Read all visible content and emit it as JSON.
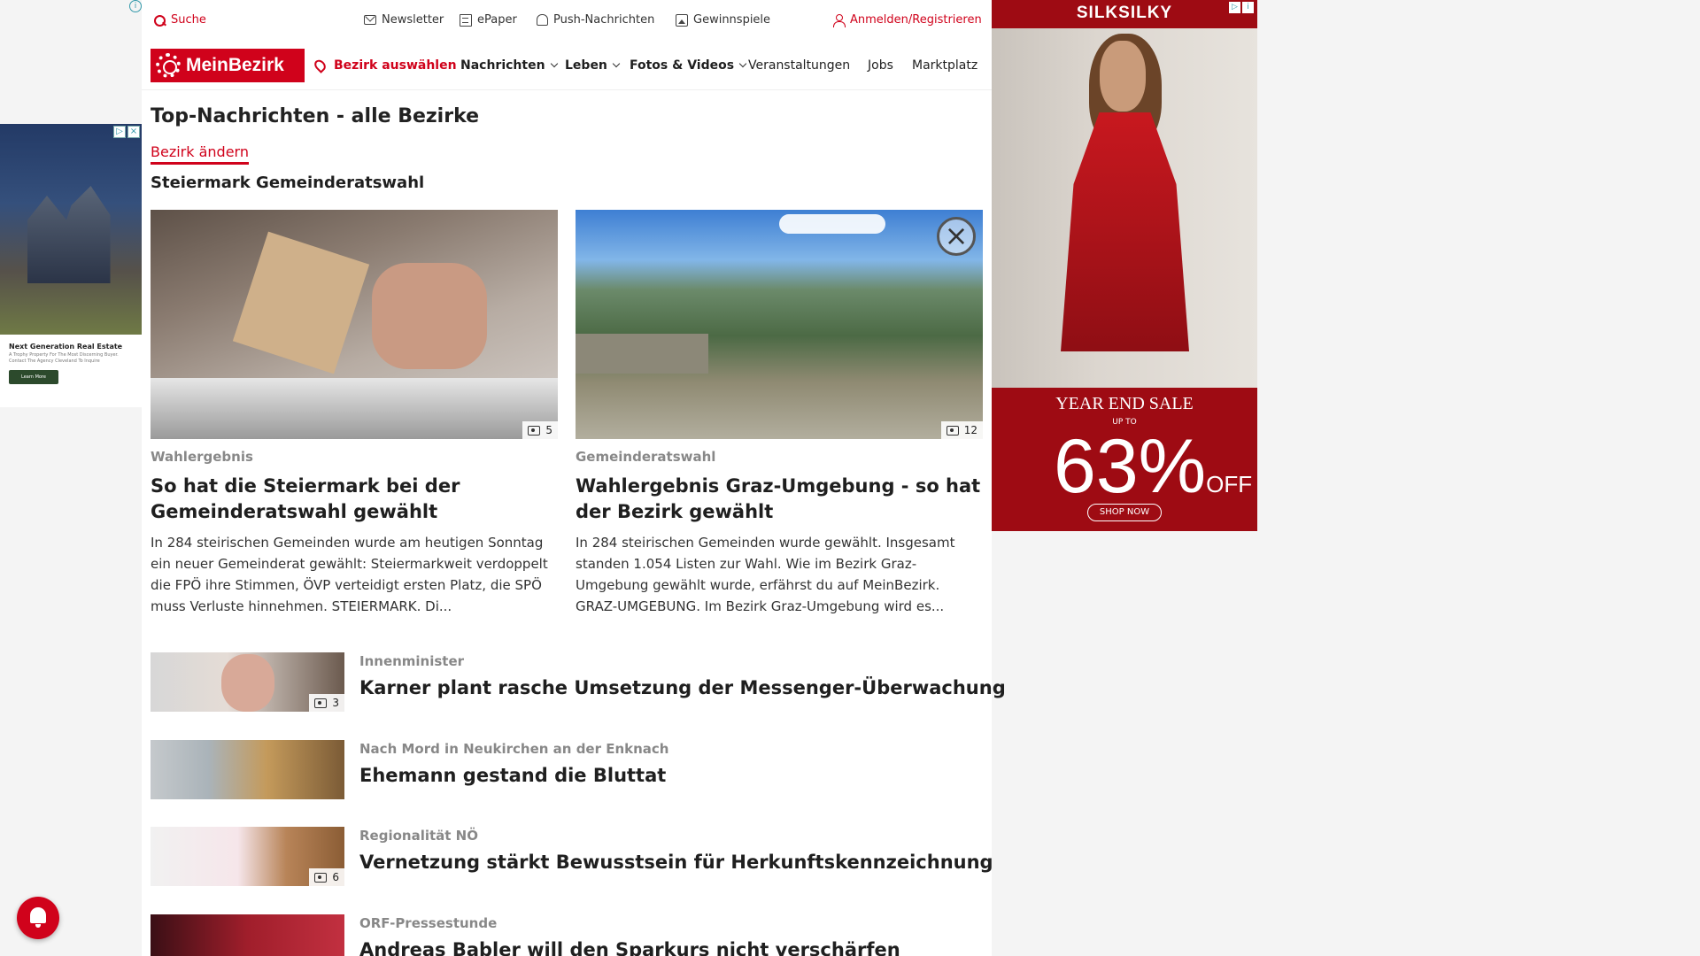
{
  "topbar": {
    "search": "Suche",
    "newsletter": "Newsletter",
    "epaper": "ePaper",
    "push": "Push-Nachrichten",
    "gewinnspiele": "Gewinnspiele",
    "login": "Anmelden/Registrieren"
  },
  "nav": {
    "logo": "MeinBezirk",
    "bezirk": "Bezirk auswählen",
    "nachrichten": "Nachrichten",
    "leben": "Leben",
    "fotos": "Fotos & Videos",
    "veranstaltungen": "Veranstaltungen",
    "jobs": "Jobs",
    "marktplatz": "Marktplatz"
  },
  "page": {
    "heading": "Top-Nachrichten - alle Bezirke",
    "change_district": "Bezirk ändern",
    "section_title": "Steiermark Gemeinderatswahl"
  },
  "cards": [
    {
      "kicker": "Wahlergebnis",
      "title": "So hat die Steiermark bei der Gemeinderatswahl gewählt",
      "teaser": "In 284 steirischen Gemeinden wurde am heutigen Sonntag ein neuer Gemeinderat gewählt: Steiermarkweit verdoppelt die FPÖ ihre Stimmen, ÖVP verteidigt ersten Platz, die SPÖ muss Verluste hinnehmen. STEIERMARK. Di...",
      "photo_count": "5"
    },
    {
      "kicker": "Gemeinderatswahl",
      "title": "Wahlergebnis Graz-Umgebung - so hat der Bezirk gewählt",
      "teaser": "In 284 steirischen Gemeinden wurde gewählt. Insgesamt standen 1.054 Listen zur Wahl. Wie im Bezirk Graz-Umgebung gewählt wurde, erfährst du auf MeinBezirk. GRAZ-UMGEBUNG. Im Bezirk Graz-Umgebung wird es...",
      "photo_count": "12"
    }
  ],
  "list": [
    {
      "kicker": "Innenminister",
      "title": "Karner plant rasche Umsetzung der Messenger-Überwachung",
      "photo_count": "3"
    },
    {
      "kicker": "Nach Mord in Neukirchen an der Enknach",
      "title": "Ehemann gestand die Bluttat",
      "photo_count": ""
    },
    {
      "kicker": "Regionalität NÖ",
      "title": "Vernetzung stärkt Bewusstsein für Herkunftskennzeichnung",
      "photo_count": "6"
    },
    {
      "kicker": "ORF-Pressestunde",
      "title": "Andreas Babler will den Sparkurs nicht verschärfen",
      "photo_count": ""
    }
  ],
  "ads": {
    "left": {
      "title": "Next Generation Real Estate",
      "body": "A Trophy Property For The Most Discerning Buyer. Contact The Agency Cleveland To Inquire",
      "cta": "Learn More"
    },
    "right": {
      "brand": "SILKSILKY",
      "headline": "YEAR END SALE",
      "upto": "UP TO",
      "percent": "63%",
      "off": "OFF",
      "cta": "SHOP NOW"
    }
  },
  "colors": {
    "brand_red": "#d0021b",
    "ad_red": "#9e0b13"
  }
}
